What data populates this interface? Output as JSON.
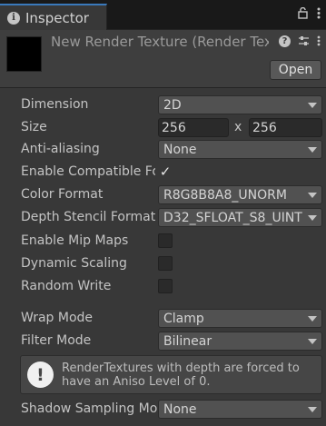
{
  "tab": {
    "label": "Inspector",
    "icon": "info-icon"
  },
  "tab_tools": {
    "lock": "lock-icon",
    "menu": "more-vertical-icon"
  },
  "header": {
    "title": "New Render Texture (Render Texture)",
    "open_label": "Open",
    "icons": [
      "help-icon",
      "preset-icon",
      "more-vertical-icon"
    ]
  },
  "fields": {
    "dimension": {
      "label": "Dimension",
      "value": "2D"
    },
    "size": {
      "label": "Size",
      "width": "256",
      "sep": "x",
      "height": "256"
    },
    "anti_aliasing": {
      "label": "Anti-aliasing",
      "value": "None"
    },
    "enable_compatible": {
      "label": "Enable Compatible Format",
      "checked": true
    },
    "color_format": {
      "label": "Color Format",
      "value": "R8G8B8A8_UNORM"
    },
    "depth_stencil": {
      "label": "Depth Stencil Format",
      "value": "D32_SFLOAT_S8_UINT"
    },
    "enable_mip_maps": {
      "label": "Enable Mip Maps",
      "checked": false
    },
    "dynamic_scaling": {
      "label": "Dynamic Scaling",
      "checked": false
    },
    "random_write": {
      "label": "Random Write",
      "checked": false
    },
    "wrap_mode": {
      "label": "Wrap Mode",
      "value": "Clamp"
    },
    "filter_mode": {
      "label": "Filter Mode",
      "value": "Bilinear"
    },
    "shadow_sampling": {
      "label": "Shadow Sampling Mode",
      "value": "None"
    }
  },
  "helpbox": {
    "text": "RenderTextures with depth are forced to have an Aniso Level of 0."
  },
  "colors": {
    "accent": "#3a79bb",
    "background": "#383838",
    "tabbar": "#191919"
  }
}
